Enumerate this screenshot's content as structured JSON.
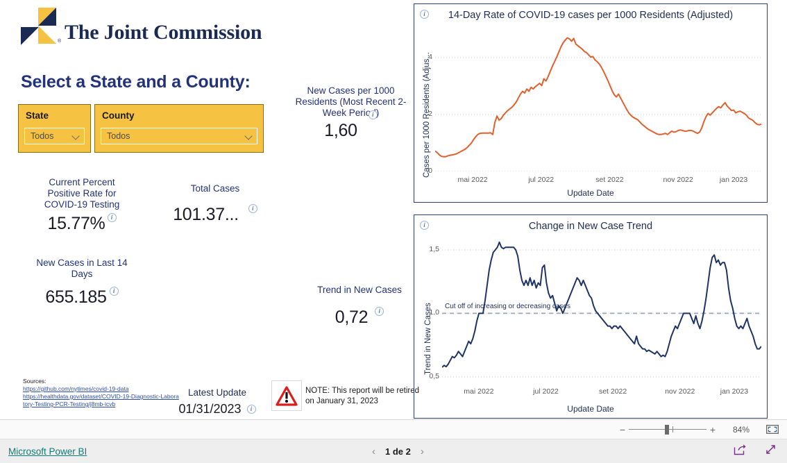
{
  "brand": {
    "logo_text": "The Joint Commission",
    "logo_registered": "®",
    "navy": "#1b2a52",
    "gold": "#F5C242"
  },
  "header": {
    "select_title": "Select a State and a County:"
  },
  "slicers": [
    {
      "title": "State",
      "value": "Todos",
      "icon": "chevron-down-icon"
    },
    {
      "title": "County",
      "value": "Todos",
      "icon": "chevron-down-icon"
    }
  ],
  "kpis": {
    "positive_rate": {
      "label": "Current Percent Positive Rate for COVID-19 Testing",
      "value": "15.77%",
      "info": "info-icon"
    },
    "total_cases": {
      "label": "Total Cases",
      "value": "101.37...",
      "info": "info-icon"
    },
    "new_per_1000": {
      "label": "New Cases per 1000 Residents (Most Recent 2-Week Period)",
      "value": "1,60",
      "info": "info-icon"
    },
    "new_last_14": {
      "label": "New Cases in Last 14 Days",
      "value": "655.185",
      "info": "info-icon"
    },
    "trend_new_cases": {
      "label": "Trend in New Cases",
      "value": "0,72",
      "info": "info-icon"
    }
  },
  "sources": {
    "heading": "Sources:",
    "links": [
      "https://github.com/nytimes/covid-19-data",
      "https://healthdata.gov/dataset/COVID-19-Diagnostic-Laboratory-Testing-PCR-Testing/j8mb-icvb"
    ]
  },
  "latest_update": {
    "label": "Latest Update",
    "value": "01/31/2023",
    "info": "info-icon"
  },
  "note": {
    "icon": "warning-triangle-icon",
    "text": "NOTE:  This report will be retired on January 31, 2023"
  },
  "zoom_bar": {
    "minus": "−",
    "plus": "+",
    "percent": "84%",
    "fit_icon": "fit-to-page-icon"
  },
  "status_bar": {
    "powerbi_link": "Microsoft Power BI",
    "prev_icon": "chevron-left-icon",
    "next_icon": "chevron-right-icon",
    "page_text": "1 de 2",
    "share_icon": "share-icon",
    "fullscreen_icon": "fullscreen-icon"
  },
  "chart_data": [
    {
      "id": "rate-chart",
      "type": "line",
      "title": "14-Day Rate of COVID-19 cases per 1000 Residents (Adjusted)",
      "xlabel": "Update Date",
      "ylabel": "Cases per 1000 Residents (Adjus...",
      "ylabel_full": "Cases per 1000 Residents (Adjusted)",
      "line_color": "#E2602C",
      "grid": true,
      "legend": "none",
      "ylim": [
        0,
        5.2
      ],
      "yticks": [
        "0",
        "2",
        "4"
      ],
      "ytick_values": [
        0,
        2,
        4
      ],
      "xticks": [
        "mai 2022",
        "jul 2022",
        "set 2022",
        "nov 2022",
        "jan 2023"
      ],
      "xtick_positions": [
        0.115,
        0.325,
        0.535,
        0.745,
        0.915
      ],
      "values": [
        0.72,
        0.66,
        0.58,
        0.53,
        0.52,
        0.52,
        0.55,
        0.57,
        0.58,
        0.6,
        0.62,
        0.66,
        0.7,
        0.74,
        0.78,
        0.84,
        0.92,
        1.0,
        1.12,
        1.22,
        1.3,
        1.34,
        1.35,
        1.35,
        1.35,
        1.35,
        1.36,
        1.3,
        1.72,
        1.95,
        1.8,
        1.86,
        1.98,
        2.06,
        2.14,
        2.2,
        2.26,
        2.34,
        2.44,
        2.58,
        2.72,
        2.82,
        2.76,
        2.9,
        2.82,
        2.96,
        2.9,
        2.98,
        3.04,
        3.1,
        3.02,
        3.26,
        3.18,
        3.34,
        3.52,
        3.7,
        3.86,
        4.02,
        4.2,
        4.38,
        4.52,
        4.62,
        4.7,
        4.66,
        4.58,
        4.68,
        4.48,
        4.42,
        4.36,
        4.3,
        4.22,
        4.18,
        4.1,
        4.02,
        4.04,
        3.92,
        3.86,
        3.78,
        3.66,
        3.52,
        3.36,
        3.2,
        3.02,
        2.84,
        2.7,
        2.62,
        2.72,
        2.58,
        2.44,
        2.3,
        2.16,
        2.04,
        1.96,
        1.9,
        1.86,
        1.82,
        1.74,
        1.66,
        1.6,
        1.54,
        1.48,
        1.44,
        1.4,
        1.36,
        1.32,
        1.3,
        1.3,
        1.32,
        1.34,
        1.3,
        1.36,
        1.42,
        1.38,
        1.4,
        1.44,
        1.46,
        1.44,
        1.42,
        1.42,
        1.44,
        1.44,
        1.42,
        1.38,
        1.34,
        1.38,
        1.52,
        1.74,
        1.92,
        2.04,
        1.98,
        2.06,
        2.14,
        2.22,
        2.28,
        2.24,
        2.34,
        2.42,
        2.3,
        2.22,
        2.14,
        2.16,
        2.06,
        2.1,
        2.12,
        2.08,
        2.04,
        1.98,
        1.88,
        1.84,
        1.8,
        1.72,
        1.66,
        1.64,
        1.66
      ]
    },
    {
      "id": "trend-chart",
      "type": "line",
      "title": "Change in New Case Trend",
      "xlabel": "Update Date",
      "ylabel": "Trend in New Cases",
      "line_color": "#1F3465",
      "grid": true,
      "legend": "none",
      "ylim": [
        0.45,
        1.62
      ],
      "yticks": [
        "0,5",
        "1,0",
        "1,5"
      ],
      "ytick_values": [
        0.5,
        1.0,
        1.5
      ],
      "xticks": [
        "mai 2022",
        "jul 2022",
        "set 2022",
        "nov 2022",
        "jan 2023"
      ],
      "xtick_positions": [
        0.115,
        0.325,
        0.535,
        0.745,
        0.915
      ],
      "reference_line": {
        "value": 1.0,
        "label": "Cut off of increasing or decreasing cases",
        "style": "dashed",
        "color": "#9aa4c0"
      },
      "values": [
        0.575,
        0.59,
        0.58,
        0.6,
        0.63,
        0.66,
        0.65,
        0.67,
        0.7,
        0.68,
        0.66,
        0.7,
        0.74,
        0.78,
        0.76,
        0.8,
        0.86,
        0.94,
        1.0,
        1.0,
        1.0,
        1.1,
        1.22,
        1.34,
        1.42,
        1.48,
        1.5,
        1.52,
        1.56,
        1.52,
        1.51,
        1.52,
        1.52,
        1.52,
        1.52,
        1.52,
        1.5,
        1.45,
        1.34,
        1.26,
        1.22,
        1.26,
        1.22,
        1.28,
        1.22,
        1.26,
        1.2,
        1.24,
        1.22,
        1.36,
        1.38,
        1.24,
        1.16,
        1.12,
        1.14,
        1.08,
        1.02,
        1.06,
        1.04,
        1.0,
        1.04,
        1.08,
        1.12,
        1.16,
        1.2,
        1.24,
        1.28,
        1.26,
        1.22,
        1.26,
        1.22,
        1.18,
        1.14,
        1.12,
        1.06,
        1.02,
        1.0,
        0.98,
        0.96,
        0.94,
        0.92,
        0.9,
        0.9,
        0.88,
        0.9,
        0.9,
        0.88,
        0.9,
        0.88,
        0.86,
        0.84,
        0.82,
        0.8,
        0.78,
        0.76,
        0.82,
        0.76,
        0.74,
        0.72,
        0.72,
        0.7,
        0.71,
        0.7,
        0.69,
        0.68,
        0.7,
        0.68,
        0.66,
        0.67,
        0.66,
        0.7,
        0.76,
        0.82,
        0.86,
        0.9,
        0.88,
        0.92,
        0.96,
        1.0,
        1.0,
        1.0,
        1.0,
        0.96,
        0.92,
        0.98,
        0.92,
        0.88,
        0.94,
        1.02,
        1.12,
        1.24,
        1.36,
        1.44,
        1.46,
        1.4,
        1.42,
        1.38,
        1.4,
        1.4,
        1.34,
        1.2,
        1.1,
        1.04,
        0.96,
        0.9,
        0.88,
        0.9,
        0.88,
        0.92,
        0.96,
        0.9,
        0.86,
        0.82,
        0.76,
        0.72,
        0.72,
        0.74
      ]
    }
  ]
}
